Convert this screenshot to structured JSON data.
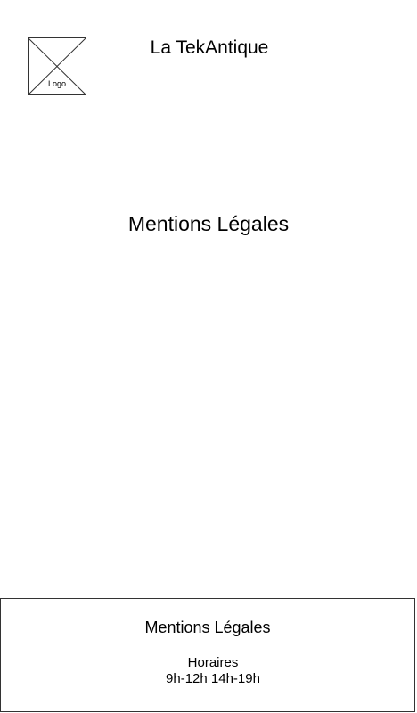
{
  "header": {
    "logo_label": "Logo",
    "site_title": "La TekAntique"
  },
  "main": {
    "page_title": "Mentions Légales"
  },
  "footer": {
    "legal_link": "Mentions Légales",
    "hours_label": "Horaires",
    "hours_value": "9h-12h 14h-19h"
  },
  "colors": {
    "background": "#ffffff",
    "text": "#000000",
    "border": "#333333"
  }
}
